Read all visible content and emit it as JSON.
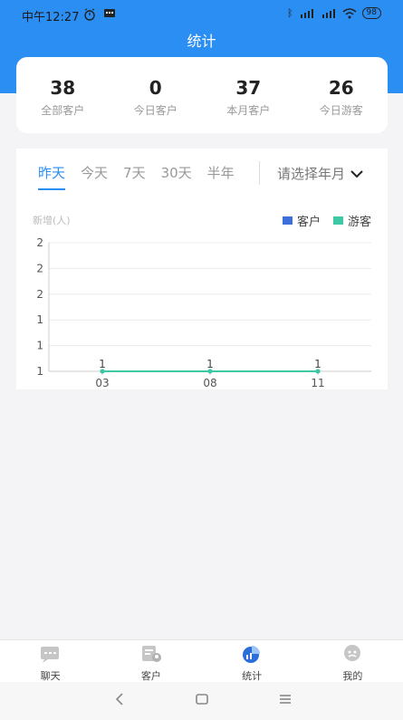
{
  "status_bar": {
    "time": "中午12:27",
    "battery": "98"
  },
  "page": {
    "title": "统计"
  },
  "summary": [
    {
      "value": "38",
      "label": "全部客户"
    },
    {
      "value": "0",
      "label": "今日客户"
    },
    {
      "value": "37",
      "label": "本月客户"
    },
    {
      "value": "26",
      "label": "今日游客"
    }
  ],
  "tabs": [
    "昨天",
    "今天",
    "7天",
    "30天",
    "半年"
  ],
  "active_tab": "昨天",
  "date_select": {
    "label": "请选择年月"
  },
  "chart_data": {
    "type": "line",
    "ylabel": "新增(人)",
    "x": [
      "03",
      "08",
      "11"
    ],
    "y_ticks": [
      "2",
      "2",
      "2",
      "1",
      "1",
      "1"
    ],
    "series": [
      {
        "name": "客户",
        "color": "#3e6fd8",
        "values": [
          1,
          1,
          1
        ]
      },
      {
        "name": "游客",
        "color": "#3ec9a6",
        "values": [
          1,
          1,
          1
        ]
      }
    ],
    "data_labels": [
      "1",
      "1",
      "1"
    ],
    "grid": true,
    "legend": "top-right"
  },
  "tabbar": [
    {
      "label": "聊天",
      "icon": "chat-icon",
      "active": false
    },
    {
      "label": "客户",
      "icon": "customer-icon",
      "active": false
    },
    {
      "label": "统计",
      "icon": "stats-icon",
      "active": true
    },
    {
      "label": "我的",
      "icon": "profile-icon",
      "active": false
    }
  ]
}
